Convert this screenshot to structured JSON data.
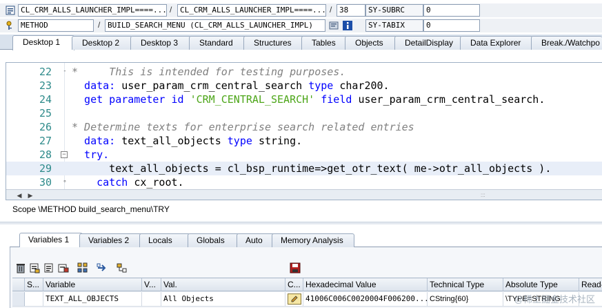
{
  "info": {
    "row1": {
      "program": "CL_CRM_ALLS_LAUNCHER_IMPL====...",
      "include": "CL_CRM_ALLS_LAUNCHER_IMPL====...",
      "line": "38",
      "sysfield_label": "SY-SUBRC",
      "sysfield_value": "0"
    },
    "row2": {
      "event_type": "METHOD",
      "event": "BUILD_SEARCH_MENU (CL_CRM_ALLS_LAUNCHER_IMPL)",
      "sysfield_label": "SY-TABIX",
      "sysfield_value": "0"
    }
  },
  "desktop_tabs": [
    "Desktop 1",
    "Desktop 2",
    "Desktop 3",
    "Standard",
    "Structures",
    "Tables",
    "Objects",
    "DetailDisplay",
    "Data Explorer",
    "Break./Watchpo"
  ],
  "code": {
    "lines": [
      {
        "num": "22",
        "marker": "-",
        "parts": [
          {
            "t": "*     This is intended for testing purposes.",
            "c": "cmt"
          }
        ]
      },
      {
        "num": "23",
        "marker": "",
        "parts": [
          {
            "t": "  data: ",
            "c": "kw"
          },
          {
            "t": "user_param_crm_central_search ",
            "c": "var"
          },
          {
            "t": "type ",
            "c": "kw"
          },
          {
            "t": "char200.",
            "c": "var"
          }
        ]
      },
      {
        "num": "24",
        "marker": "",
        "parts": [
          {
            "t": "  get parameter id ",
            "c": "kw"
          },
          {
            "t": "'CRM_CENTRAL_SEARCH' ",
            "c": "str"
          },
          {
            "t": "field ",
            "c": "kw"
          },
          {
            "t": "user_param_crm_central_search.",
            "c": "var"
          }
        ]
      },
      {
        "num": "25",
        "marker": "",
        "parts": [
          {
            "t": "",
            "c": "var"
          }
        ]
      },
      {
        "num": "26",
        "marker": "",
        "parts": [
          {
            "t": "* Determine texts for enterprise search related entries",
            "c": "cmt"
          }
        ]
      },
      {
        "num": "27",
        "marker": "",
        "parts": [
          {
            "t": "  data: ",
            "c": "kw"
          },
          {
            "t": "text_all_objects ",
            "c": "var"
          },
          {
            "t": "type ",
            "c": "kw"
          },
          {
            "t": "string.",
            "c": "var"
          }
        ]
      },
      {
        "num": "28",
        "marker": "box",
        "parts": [
          {
            "t": "  try.",
            "c": "kw"
          }
        ]
      },
      {
        "num": "29",
        "marker": "",
        "parts": [
          {
            "t": "      text_all_objects = cl_bsp_runtime=>get_otr_text( me->otr_all_objects ).",
            "c": "var"
          }
        ]
      },
      {
        "num": "30",
        "marker": "dot",
        "parts": [
          {
            "t": "    catch ",
            "c": "kw"
          },
          {
            "t": "cx_root.",
            "c": "var"
          }
        ]
      }
    ]
  },
  "scope": "Scope \\METHOD build_search_menu\\TRY",
  "var_tabs": [
    "Variables 1",
    "Variables 2",
    "Locals",
    "Globals",
    "Auto",
    "Memory Analysis"
  ],
  "table": {
    "headers": [
      "S...",
      "Variable",
      "V...",
      "Val.",
      "C...",
      "Hexadecimal Value",
      "Technical Type",
      "Absolute Type",
      "Read-"
    ],
    "rows": [
      {
        "variable": "TEXT_ALL_OBJECTS",
        "val": "All Objects",
        "hex": "41006C006C0020004F006200...",
        "tech": "CString{60}",
        "abs": "\\TYPE=STRING"
      }
    ]
  },
  "watermark": "@稀土掘金技术社区"
}
